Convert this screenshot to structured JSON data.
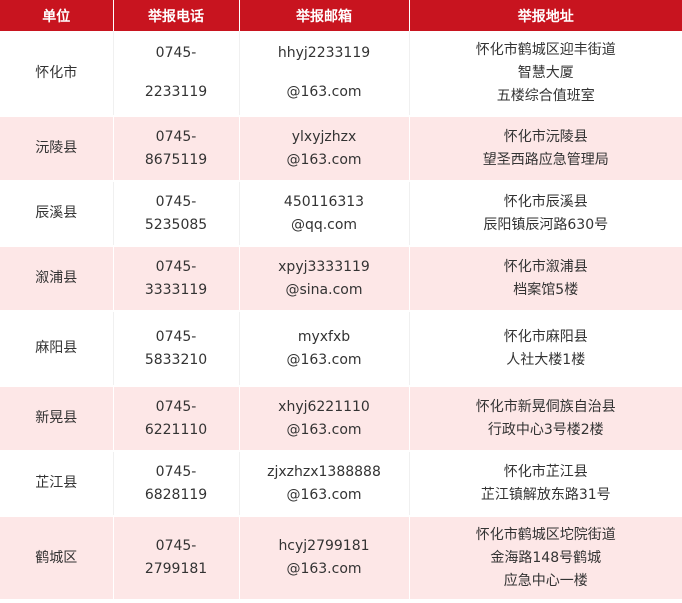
{
  "header": {
    "unit": "单位",
    "phone": "举报电话",
    "email": "举报邮箱",
    "address": "举报地址"
  },
  "rows": [
    {
      "unit": "怀化市",
      "phone": [
        "0745-",
        "2233119"
      ],
      "email": [
        "hhyj2233119",
        "@163.com"
      ],
      "address": [
        "怀化市鹤城区迎丰街道",
        "智慧大厦",
        "五楼综合值班室"
      ]
    },
    {
      "unit": "沅陵县",
      "phone": [
        "0745-",
        "8675119"
      ],
      "email": [
        "ylxyjzhzx",
        "@163.com"
      ],
      "address": [
        "怀化市沅陵县",
        "望圣西路应急管理局"
      ]
    },
    {
      "unit": "辰溪县",
      "phone": [
        "0745-",
        "5235085"
      ],
      "email": [
        "450116313",
        "@qq.com"
      ],
      "address": [
        "怀化市辰溪县",
        "辰阳镇辰河路630号"
      ]
    },
    {
      "unit": "溆浦县",
      "phone": [
        "0745-",
        "3333119"
      ],
      "email": [
        "xpyj3333119",
        "@sina.com"
      ],
      "address": [
        "怀化市溆浦县",
        "档案馆5楼"
      ]
    },
    {
      "unit": "麻阳县",
      "phone": [
        "0745-",
        "5833210"
      ],
      "email": [
        "myxfxb",
        "@163.com"
      ],
      "address": [
        "怀化市麻阳县",
        "人社大楼1楼"
      ]
    },
    {
      "unit": "新晃县",
      "phone": [
        "0745-",
        "6221110"
      ],
      "email": [
        "xhyj6221110",
        "@163.com"
      ],
      "address": [
        "怀化市新晃侗族自治县",
        "行政中心3号楼2楼"
      ]
    },
    {
      "unit": "芷江县",
      "phone": [
        "0745-",
        "6828119"
      ],
      "email": [
        "zjxzhzx1388888",
        "@163.com"
      ],
      "address": [
        "怀化市芷江县",
        "芷江镇解放东路31号"
      ]
    },
    {
      "unit": "鹤城区",
      "phone": [
        "0745-",
        "2799181"
      ],
      "email": [
        "hcyj2799181",
        "@163.com"
      ],
      "address": [
        "怀化市鹤城区坨院街道",
        "金海路148号鹤城",
        "应急中心一楼"
      ]
    }
  ],
  "colors": {
    "header_bg": "#c8141f",
    "header_text": "#ffffff",
    "stripe_bg": "#fde7e7",
    "body_text": "#333333"
  }
}
